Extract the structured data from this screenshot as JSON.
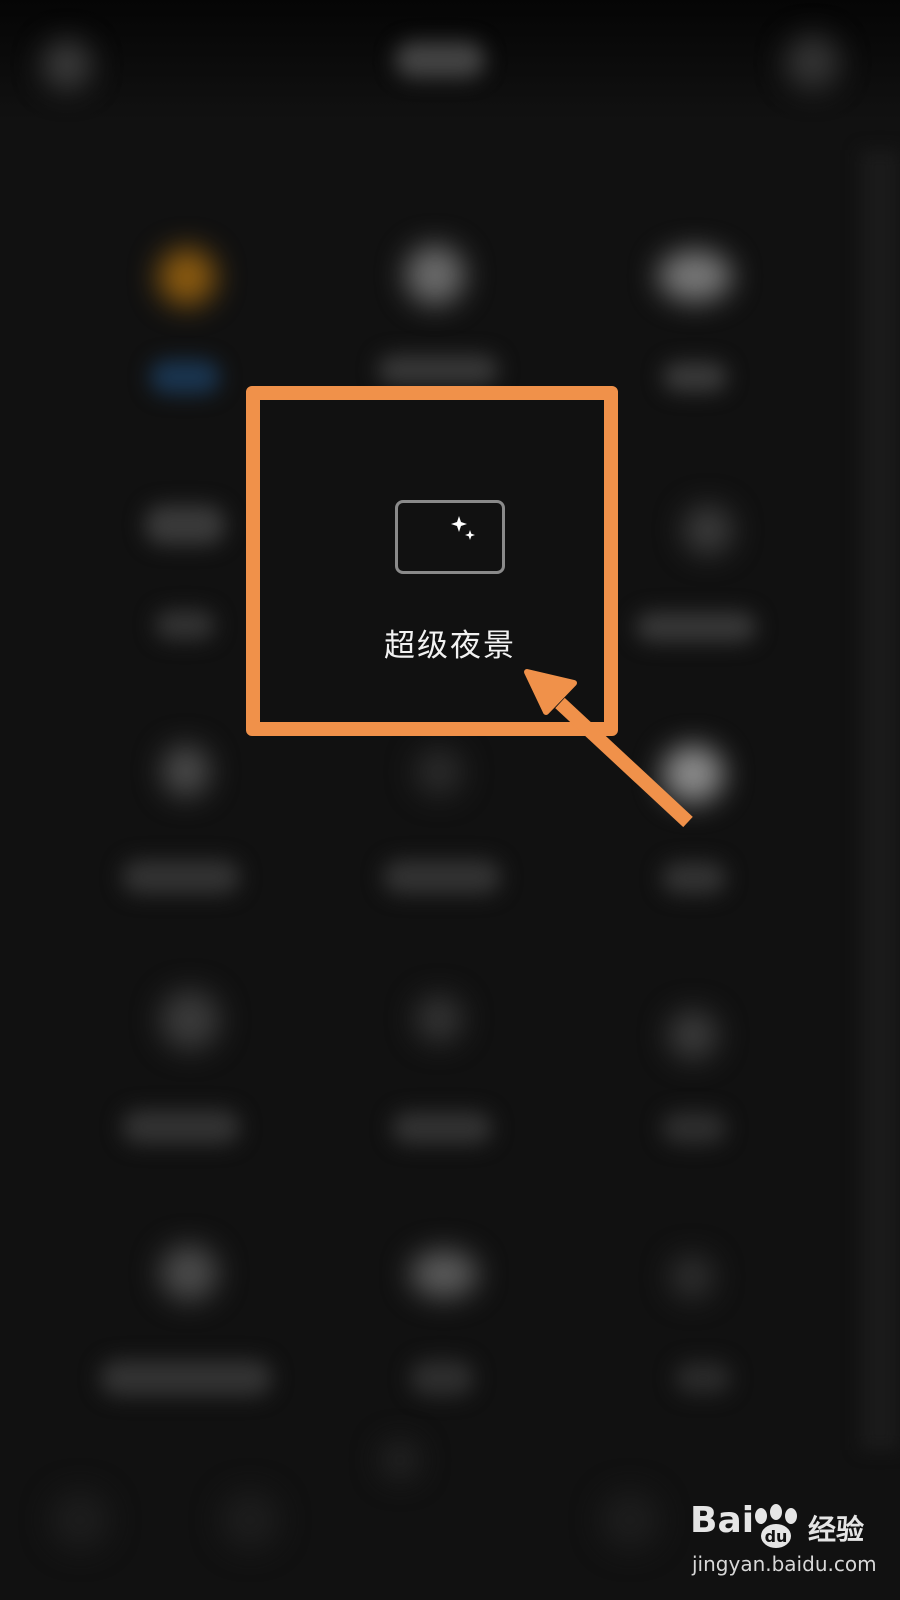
{
  "camera_mode": {
    "label": "超级夜景",
    "icon": "moon-stars-icon"
  },
  "annotation": {
    "highlight_color": "#f0914a",
    "arrow_color": "#f0914a"
  },
  "watermark": {
    "logo_text": "Bai",
    "brand": "经验",
    "url": "jingyan.baidu.com"
  }
}
